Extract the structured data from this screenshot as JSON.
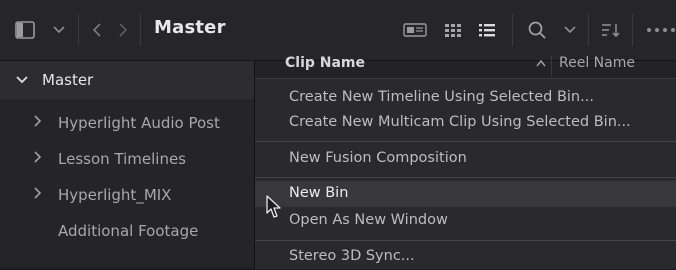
{
  "toolbar": {
    "title": "Master",
    "icons": [
      "sidebar-toggle-icon",
      "chevron-down-icon",
      "back-icon",
      "forward-icon",
      "metadata-view-icon",
      "thumbnail-view-icon",
      "list-view-icon",
      "search-icon",
      "chevron-down-icon",
      "sort-icon",
      "more-icon"
    ]
  },
  "sidebar": {
    "root": {
      "label": "Master",
      "expanded": true
    },
    "items": [
      {
        "label": "Hyperlight Audio Post",
        "has_children": true
      },
      {
        "label": "Lesson Timelines",
        "has_children": true
      },
      {
        "label": "Hyperlight_MIX",
        "has_children": true
      },
      {
        "label": "Additional Footage",
        "has_children": false
      }
    ]
  },
  "columns": {
    "clip_name": "Clip Name",
    "sort_indicator": "^",
    "reel_name": "Reel Name"
  },
  "context_menu": {
    "groups": [
      [
        {
          "label": "Create New Timeline Using Selected Bin..."
        },
        {
          "label": "Create New Multicam Clip Using Selected Bin..."
        }
      ],
      [
        {
          "label": "New Fusion Composition"
        }
      ],
      [
        {
          "label": "New Bin",
          "highlighted": true
        },
        {
          "label": "Open As New Window"
        }
      ],
      [
        {
          "label": "Stereo 3D Sync..."
        }
      ]
    ]
  },
  "colors": {
    "background": "#1c1c1e",
    "toolbar": "#262629",
    "sidebar": "#252528",
    "menu": "#2a2a2e",
    "highlight": "#38383c"
  }
}
